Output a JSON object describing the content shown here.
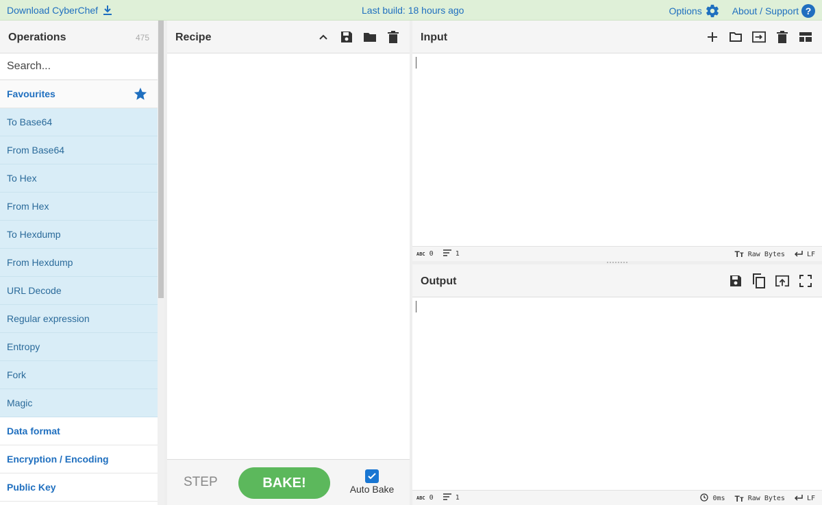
{
  "banner": {
    "download_label": "Download CyberChef",
    "build_label": "Last build: 18 hours ago",
    "options_label": "Options",
    "about_label": "About / Support"
  },
  "operations": {
    "title": "Operations",
    "count": "475",
    "search_placeholder": "Search...",
    "favourites_label": "Favourites",
    "favourites": [
      "To Base64",
      "From Base64",
      "To Hex",
      "From Hex",
      "To Hexdump",
      "From Hexdump",
      "URL Decode",
      "Regular expression",
      "Entropy",
      "Fork",
      "Magic"
    ],
    "categories": [
      "Data format",
      "Encryption / Encoding",
      "Public Key"
    ]
  },
  "recipe": {
    "title": "Recipe",
    "step_label": "STEP",
    "bake_label": "BAKE!",
    "autobake_label": "Auto Bake",
    "autobake_checked": true
  },
  "input": {
    "title": "Input",
    "value": "",
    "status": {
      "chars": "0",
      "lines": "1",
      "encoding": "Raw Bytes",
      "eol": "LF"
    }
  },
  "output": {
    "title": "Output",
    "value": "",
    "status": {
      "chars": "0",
      "lines": "1",
      "time": "0ms",
      "encoding": "Raw Bytes",
      "eol": "LF"
    }
  },
  "colors": {
    "accent": "#1f6fbf",
    "banner_bg": "#dff0d8",
    "favourite_bg": "#d9edf7",
    "bake": "#5cb85c",
    "checkbox": "#1976d2"
  }
}
